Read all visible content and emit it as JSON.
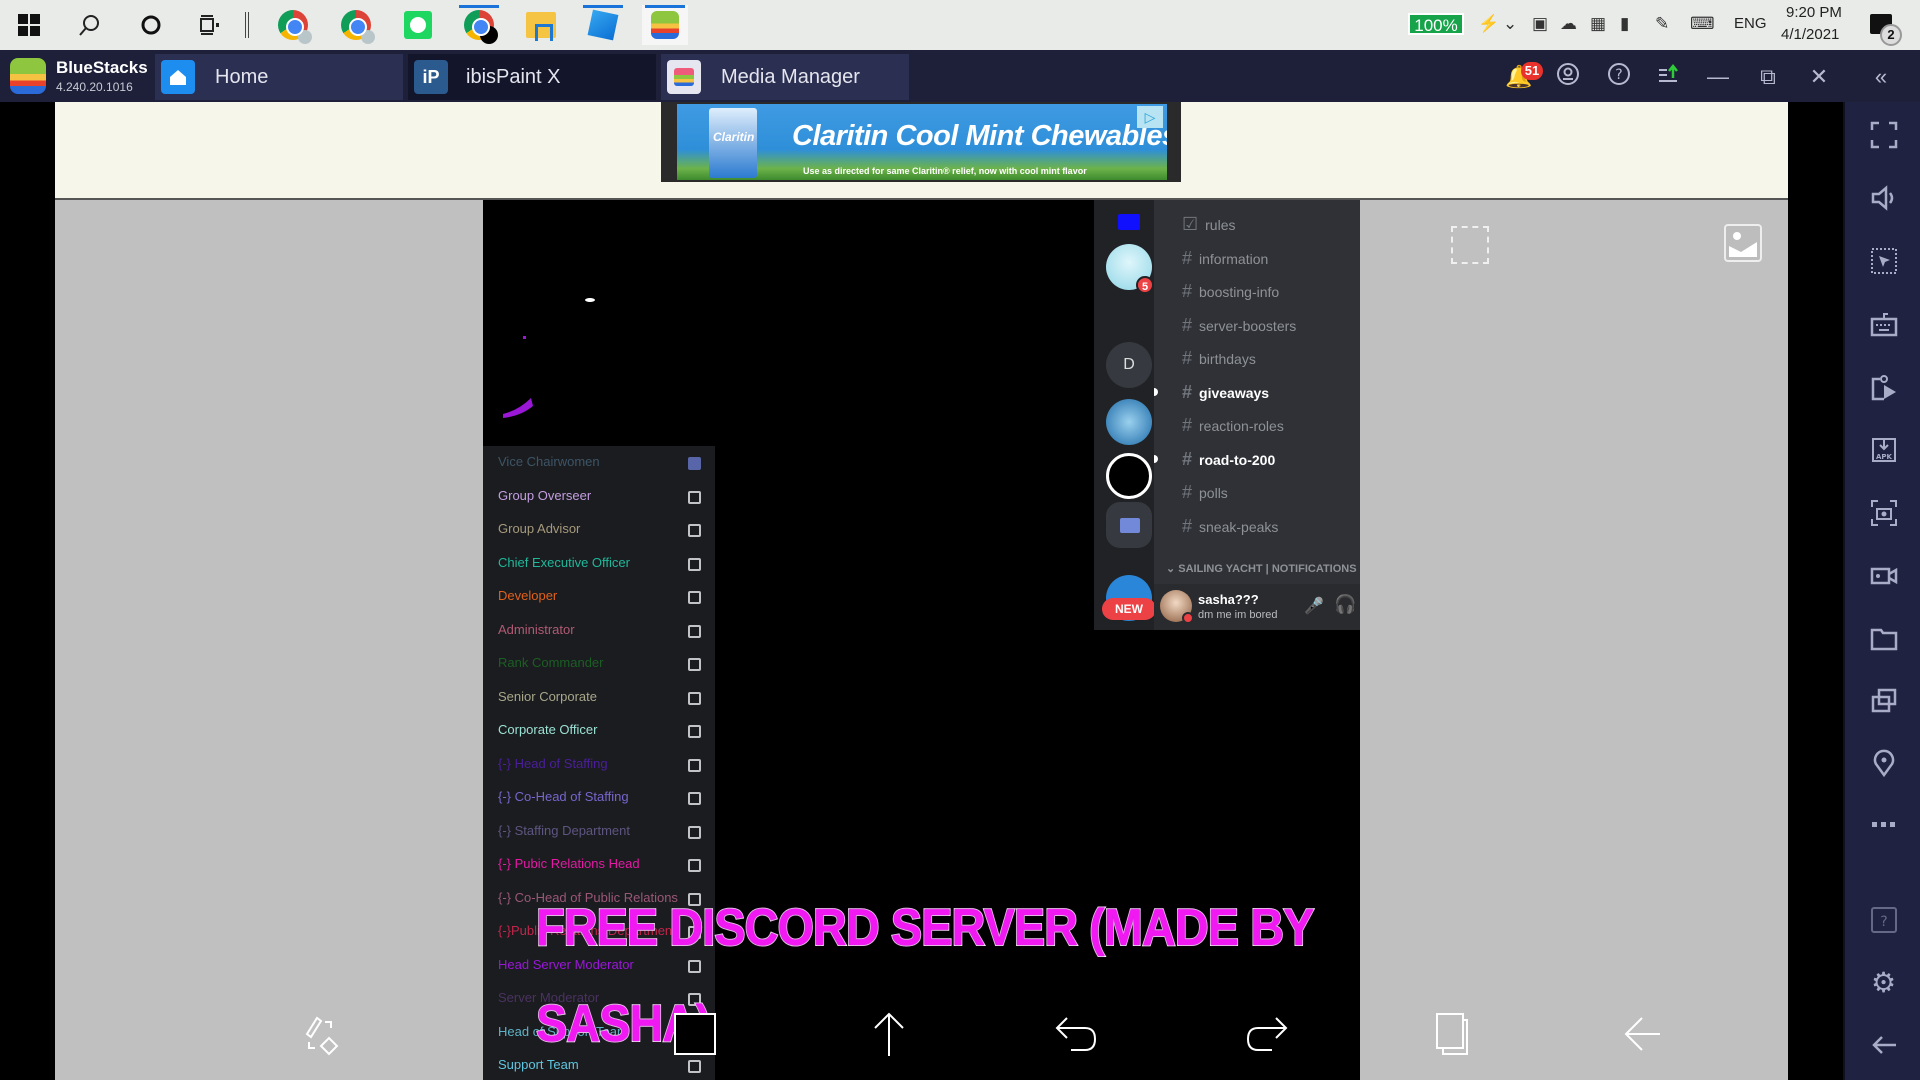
{
  "taskbar": {
    "start_icon": "windows-start-icon",
    "pinned": [
      {
        "name": "search-icon"
      },
      {
        "name": "cortana-icon"
      },
      {
        "name": "task-view-icon"
      },
      {
        "name": "chrome-profile-1-icon"
      },
      {
        "name": "chrome-profile-2-icon"
      },
      {
        "name": "spotify-icon"
      },
      {
        "name": "chrome-icon"
      },
      {
        "name": "file-explorer-icon"
      },
      {
        "name": "roblox-icon"
      },
      {
        "name": "bluestacks-icon"
      }
    ],
    "tray": {
      "battery_percent": "100%",
      "language": "ENG",
      "time": "9:20 PM",
      "date": "4/1/2021",
      "notification_count": "2"
    }
  },
  "bluestacks": {
    "app_name": "BlueStacks",
    "version": "4.240.20.1016",
    "tabs": [
      {
        "label": "Home",
        "active": false
      },
      {
        "label": "ibisPaint X",
        "active": true
      },
      {
        "label": "Media Manager",
        "active": false
      }
    ],
    "notification_badge": "51",
    "controls": [
      "notifications",
      "account",
      "help",
      "update",
      "minimize",
      "restore",
      "close",
      "collapse-sidebar"
    ],
    "sidebar": [
      {
        "name": "fullscreen-icon"
      },
      {
        "name": "volume-icon"
      },
      {
        "name": "pointer-lock-icon"
      },
      {
        "name": "keyboard-controls-icon"
      },
      {
        "name": "macro-recorder-icon"
      },
      {
        "name": "install-apk-icon"
      },
      {
        "name": "screenshot-icon"
      },
      {
        "name": "screen-record-icon"
      },
      {
        "name": "media-folder-icon"
      },
      {
        "name": "multi-instance-icon"
      },
      {
        "name": "location-icon"
      },
      {
        "name": "more-icon"
      },
      {
        "name": "help-icon"
      },
      {
        "name": "settings-icon"
      },
      {
        "name": "back-icon"
      }
    ]
  },
  "ad": {
    "headline": "Claritin Cool Mint Chewables",
    "brand": "Claritin",
    "subtext": "Use as directed for same Claritin® relief, now with cool mint flavor"
  },
  "artwork": {
    "title_line1": "FREE DISCORD SERVER (MADE BY",
    "title_line2": "SASHA)",
    "title_color": "#f019f2",
    "roles": [
      {
        "label": "Vice Chairwomen",
        "color": "#3d5566",
        "checked": true
      },
      {
        "label": "Group Overseer",
        "color": "#c39ee0",
        "checked": false
      },
      {
        "label": "Group Advisor",
        "color": "#a69a7c",
        "checked": false
      },
      {
        "label": "Chief Executive Officer",
        "color": "#1fb89a",
        "checked": false
      },
      {
        "label": "Developer",
        "color": "#e0611a",
        "checked": false
      },
      {
        "label": "Administrator",
        "color": "#b05a73",
        "checked": false
      },
      {
        "label": "Rank Commander",
        "color": "#1c5e24",
        "checked": false
      },
      {
        "label": "Senior Corporate",
        "color": "#a8a78a",
        "checked": false
      },
      {
        "label": "Corporate Officer",
        "color": "#9be0d4",
        "checked": false
      },
      {
        "label": "{-} Head of Staffing",
        "color": "#4b1e9c",
        "checked": false
      },
      {
        "label": "{-} Co-Head of Staffing",
        "color": "#7766cc",
        "checked": false
      },
      {
        "label": "{-} Staffing Department",
        "color": "#5e5580",
        "checked": false
      },
      {
        "label": "{-} Pubic Relations Head",
        "color": "#e31aa3",
        "checked": false
      },
      {
        "label": "{-} Co-Head of Public Relations",
        "color": "#9a5778",
        "checked": false
      },
      {
        "label": "{-}Public Relations Department",
        "color": "#c2254a",
        "checked": false
      },
      {
        "label": "Head Server Moderator",
        "color": "#9a17d8",
        "checked": false
      },
      {
        "label": "Server Moderator",
        "color": "#4a3260",
        "checked": false
      },
      {
        "label": "Head of Support Team",
        "color": "#5fb3c6",
        "checked": false
      },
      {
        "label": "Support Team",
        "color": "#5fc6e0",
        "checked": false
      }
    ],
    "discord": {
      "channels": [
        {
          "name": "rules",
          "type": "rules",
          "unread": false
        },
        {
          "name": "information",
          "type": "text",
          "unread": false
        },
        {
          "name": "boosting-info",
          "type": "text",
          "unread": false
        },
        {
          "name": "server-boosters",
          "type": "text",
          "unread": false
        },
        {
          "name": "birthdays",
          "type": "text",
          "unread": false
        },
        {
          "name": "giveaways",
          "type": "text",
          "unread": true
        },
        {
          "name": "reaction-roles",
          "type": "text",
          "unread": false
        },
        {
          "name": "road-to-200",
          "type": "text",
          "unread": true
        },
        {
          "name": "polls",
          "type": "text",
          "unread": false
        },
        {
          "name": "sneak-peaks",
          "type": "text",
          "unread": false
        }
      ],
      "category": "SAILING YACHT | NOTIFICATIONS",
      "guild_badge": "5",
      "guild_letter": "D",
      "new_label": "NEW",
      "user": {
        "name": "sasha???",
        "status": "dm me im bored"
      }
    }
  },
  "ibispaint_toolbar": [
    {
      "name": "transform-tool-icon"
    },
    {
      "name": "color-swatch-icon"
    },
    {
      "name": "export-up-icon"
    },
    {
      "name": "undo-icon"
    },
    {
      "name": "redo-icon"
    },
    {
      "name": "layers-icon"
    },
    {
      "name": "back-arrow-icon"
    }
  ]
}
